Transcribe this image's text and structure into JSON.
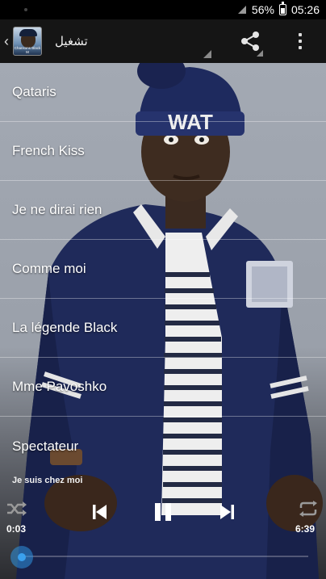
{
  "status_bar": {
    "battery": "56%",
    "time": "05:26"
  },
  "action_bar": {
    "title": "تشغيل",
    "app_icon_caption": "Chansons Black M"
  },
  "songs": [
    {
      "title": "Qataris"
    },
    {
      "title": "French Kiss"
    },
    {
      "title": "Je ne dirai rien"
    },
    {
      "title": "Comme moi"
    },
    {
      "title": "La légende Black"
    },
    {
      "title": "Mme Pavoshko"
    },
    {
      "title": "Spectateur"
    }
  ],
  "player": {
    "now_playing": "Je suis chez moi",
    "elapsed": "0:03",
    "duration": "6:39",
    "progress": 0.0075
  },
  "artwork": {
    "cap_text": "WAT"
  },
  "colors": {
    "accent": "#3aa0ee",
    "action_bar": "#151515"
  }
}
